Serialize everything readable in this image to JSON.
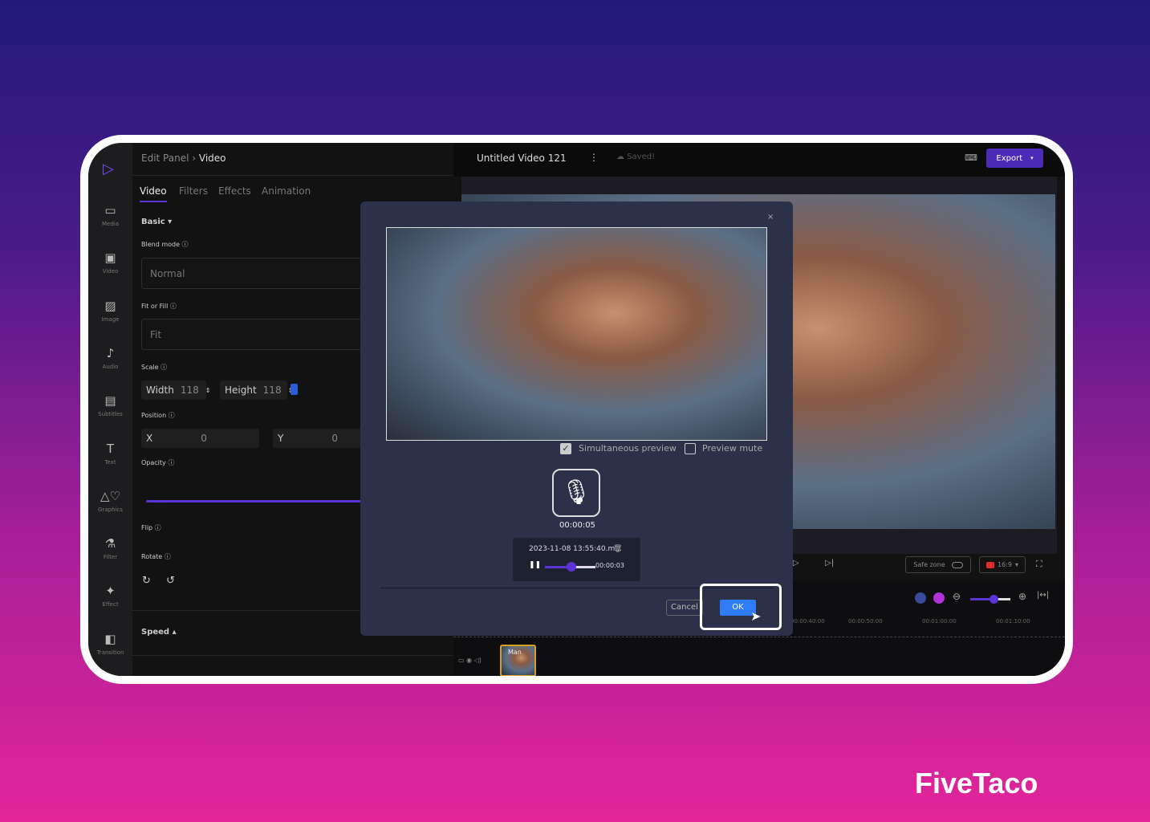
{
  "brand": {
    "logo_text": "FiveTaco"
  },
  "sidebar": {
    "items": [
      {
        "label": "Media",
        "icon": "folder-icon"
      },
      {
        "label": "Video",
        "icon": "video-camera-icon"
      },
      {
        "label": "Image",
        "icon": "image-icon"
      },
      {
        "label": "Audio",
        "icon": "audio-file-icon"
      },
      {
        "label": "Subtitles",
        "icon": "subtitles-icon"
      },
      {
        "label": "Text",
        "icon": "text-icon"
      },
      {
        "label": "Graphics",
        "icon": "shapes-icon"
      },
      {
        "label": "Filter",
        "icon": "filter-icon"
      },
      {
        "label": "Effect",
        "icon": "sparkle-icon"
      },
      {
        "label": "Transition",
        "icon": "transition-icon"
      }
    ]
  },
  "panel": {
    "breadcrumb": {
      "parent": "Edit Panel",
      "sep": "›",
      "current": "Video"
    },
    "tabs": [
      {
        "label": "Video",
        "active": true
      },
      {
        "label": "Filters"
      },
      {
        "label": "Effects"
      },
      {
        "label": "Animation"
      }
    ],
    "basic": "Basic",
    "blend_mode": "Blend mode",
    "blend_value": "Normal",
    "fit_fill": "Fit or Fill",
    "fit_value": "Fit",
    "scale": "Scale",
    "width_label": "Width",
    "width_value": "118",
    "height_label": "Height",
    "height_value": "118",
    "position": "Position",
    "x_label": "X",
    "x_value": "0",
    "y_label": "Y",
    "y_value": "0",
    "opacity": "Opacity",
    "flip": "Flip",
    "rotate": "Rotate",
    "speed": "Speed"
  },
  "topbar": {
    "title": "Untitled Video 121",
    "saved": "Saved!",
    "export": "Export"
  },
  "controls": {
    "safe_zone": "Safe zone",
    "aspect": "16:9"
  },
  "timeline": {
    "ticks": [
      "00:00:40:00",
      "00:00:50:00",
      "00:01:00:00",
      "00:01:10:00"
    ],
    "clip_label": "Man"
  },
  "dialog": {
    "close": "×",
    "simultaneous_preview": "Simultaneous preview",
    "simultaneous_checked": true,
    "preview_mute": "Preview mute",
    "preview_mute_checked": false,
    "record_time": "00:00:05",
    "recording_name": "2023-11-08 13:55:40.m...",
    "playback_time": "00:00:03",
    "playback_progress": 0.5,
    "cancel": "Cancel",
    "ok": "OK"
  },
  "colors": {
    "accent": "#5b34d6",
    "ok_blue": "#2f7df6",
    "dialog_bg": "#2a3148"
  }
}
